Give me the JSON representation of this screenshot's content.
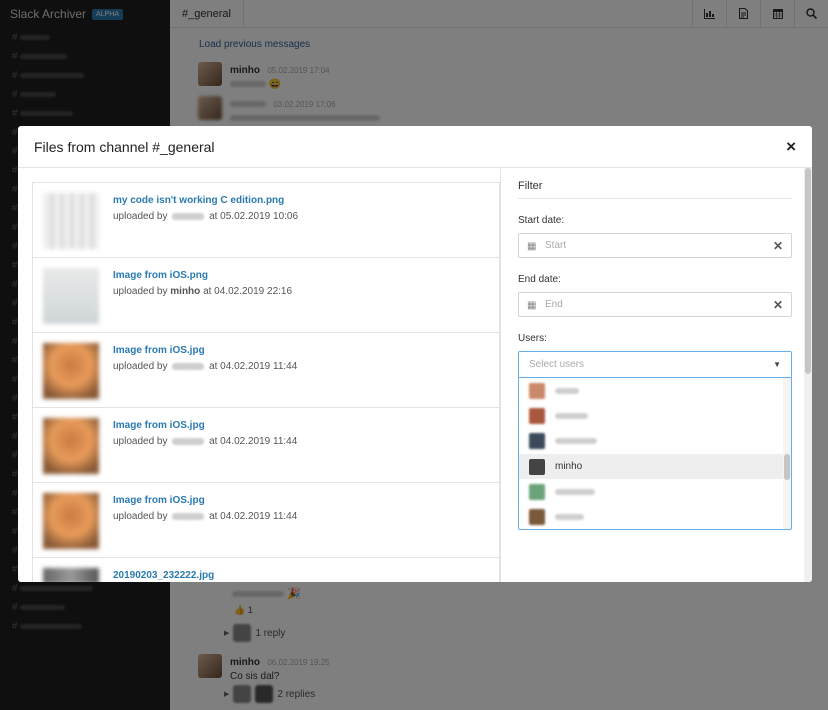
{
  "app": {
    "title": "Slack Archiver",
    "badge": "ALPHA"
  },
  "sidebar": {
    "channels": [
      "#",
      "#",
      "#",
      "#",
      "#",
      "#",
      "#",
      "#",
      "#",
      "#",
      "#",
      "#",
      "#",
      "#",
      "#",
      "#",
      "#",
      "#",
      "#",
      "#",
      "#",
      "#",
      "#",
      "#",
      "#",
      "#",
      "#",
      "#",
      "#",
      "#",
      "#",
      "#"
    ]
  },
  "topbar": {
    "channel": "#_general",
    "icons": [
      "chart-icon",
      "file-icon",
      "calendar-icon",
      "search-icon"
    ]
  },
  "messages": {
    "load_previous": "Load previous messages",
    "first": {
      "name": "minho",
      "time": "05.02.2019 17:04",
      "emoji": "😄"
    },
    "second": {
      "time": "03.02.2019 17:06"
    },
    "reaction_count": "1",
    "reply_1": "1 reply",
    "third": {
      "name": "minho",
      "time": "06.02.2019 19:25",
      "text": "Co sis dal?"
    },
    "reply_2": "2 replies",
    "party_emoji": "🎉"
  },
  "modal": {
    "title": "Files from channel #_general",
    "close": "×",
    "files": [
      {
        "name": "my code isn't working C edition.png",
        "prefix": "uploaded by",
        "uploader": "",
        "date": "at 05.02.2019 10:06",
        "thumb": "code"
      },
      {
        "name": "Image from iOS.png",
        "prefix": "uploaded by",
        "uploader": "minho",
        "date": "at 04.02.2019 22:16",
        "thumb": "ios"
      },
      {
        "name": "Image from iOS.jpg",
        "prefix": "uploaded by",
        "uploader": "",
        "date": "at 04.02.2019 11:44",
        "thumb": "photo"
      },
      {
        "name": "Image from iOS.jpg",
        "prefix": "uploaded by",
        "uploader": "",
        "date": "at 04.02.2019 11:44",
        "thumb": "photo"
      },
      {
        "name": "Image from iOS.jpg",
        "prefix": "uploaded by",
        "uploader": "",
        "date": "at 04.02.2019 11:44",
        "thumb": "photo"
      },
      {
        "name": "20190203_232222.jpg",
        "prefix": "",
        "uploader": "",
        "date": "",
        "thumb": "dark"
      }
    ],
    "filter": {
      "title": "Filter",
      "start_label": "Start date:",
      "start_placeholder": "Start",
      "end_label": "End date:",
      "end_placeholder": "End",
      "users_label": "Users:",
      "users_placeholder": "Select users",
      "user_options": [
        "",
        "",
        "",
        "minho",
        "",
        ""
      ],
      "highlighted_option": "minho",
      "clear": "✕"
    }
  }
}
